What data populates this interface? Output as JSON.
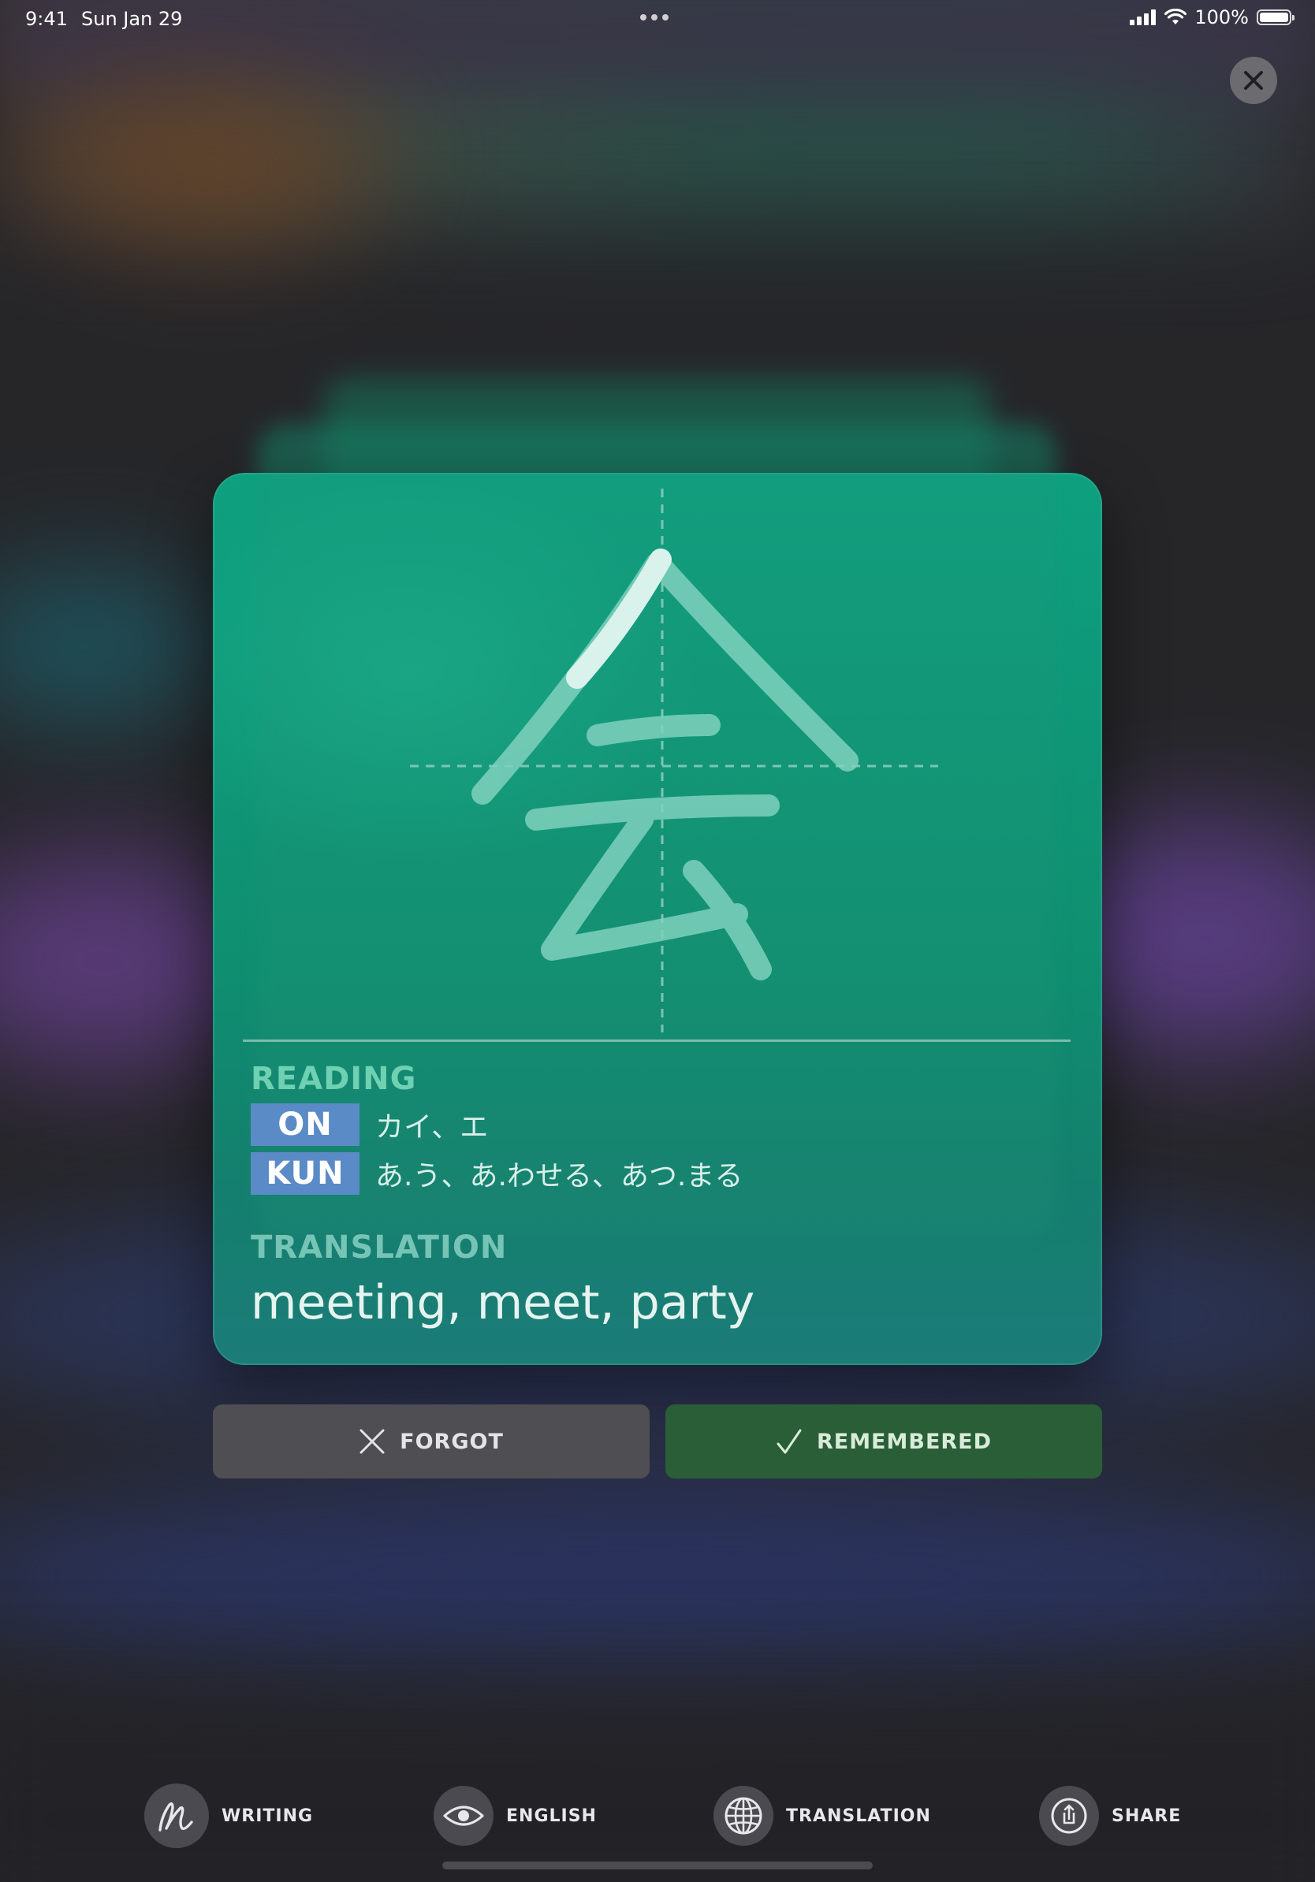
{
  "status_bar": {
    "time": "9:41",
    "date": "Sun Jan 29",
    "battery": "100%"
  },
  "card": {
    "kanji": "会",
    "reading_label": "READING",
    "on_tag": "ON",
    "on_reading": "カイ、エ",
    "kun_tag": "KUN",
    "kun_reading": "あ.う、あ.わせる、あつ.まる",
    "translation_label": "TRANSLATION",
    "translation": "meeting, meet, party"
  },
  "actions": {
    "forgot": "FORGOT",
    "remembered": "REMEMBERED"
  },
  "toolbar": {
    "items": [
      {
        "label": "WRITING",
        "icon": "writing-icon"
      },
      {
        "label": "ENGLISH",
        "icon": "eye-icon"
      },
      {
        "label": "TRANSLATION",
        "icon": "globe-icon"
      },
      {
        "label": "SHARE",
        "icon": "share-icon"
      }
    ]
  },
  "colors": {
    "card": "#0f9677",
    "tag": "#5b8bc6",
    "forgot_button": "#4f4f53",
    "remembered_button": "#2a5e37",
    "section_label": "#6fd0b2"
  }
}
